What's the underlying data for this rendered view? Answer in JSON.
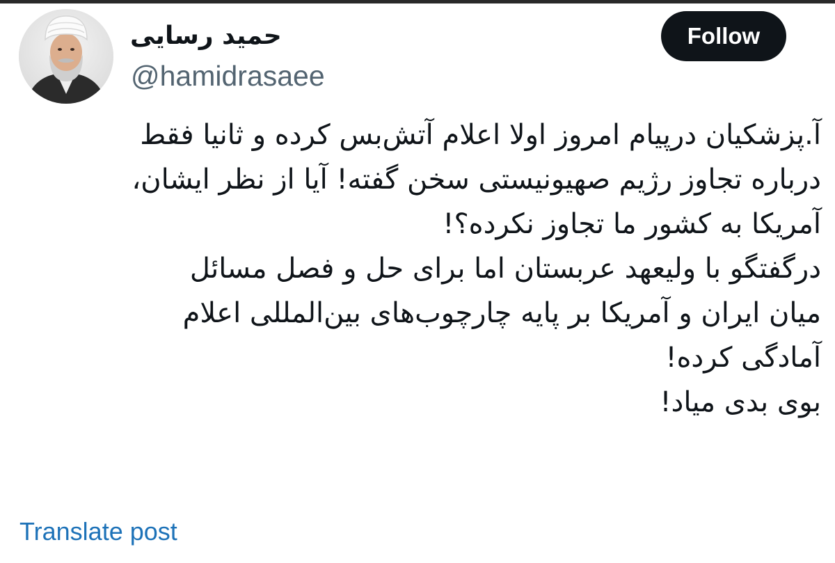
{
  "author": {
    "display_name": "حمید رسایی",
    "handle": "@hamidrasaee",
    "avatar_icon": "profile-photo"
  },
  "follow_label": "Follow",
  "tweet": {
    "lines": [
      "آ.پزشکیان درپیام امروز اولا اعلام آتش‌بس کرده و ثانیا فقط",
      "درباره تجاوز رژیم صهیونیستی سخن گفته! آیا از نظر ایشان،",
      "آمریکا به کشور ما تجاوز نکرده؟!",
      "درگفتگو با ولیعهد عربستان اما برای حل و فصل مسائل",
      "میان ایران و آمریکا بر پایه چارچوب‌های بین‌المللی اعلام",
      "آمادگی کرده!",
      "بوی بدی میاد!"
    ]
  },
  "translate_label": "Translate post",
  "colors": {
    "follow_bg": "#0f1419",
    "link": "#1d72b8",
    "handle": "#536471",
    "text": "#0f1419"
  }
}
